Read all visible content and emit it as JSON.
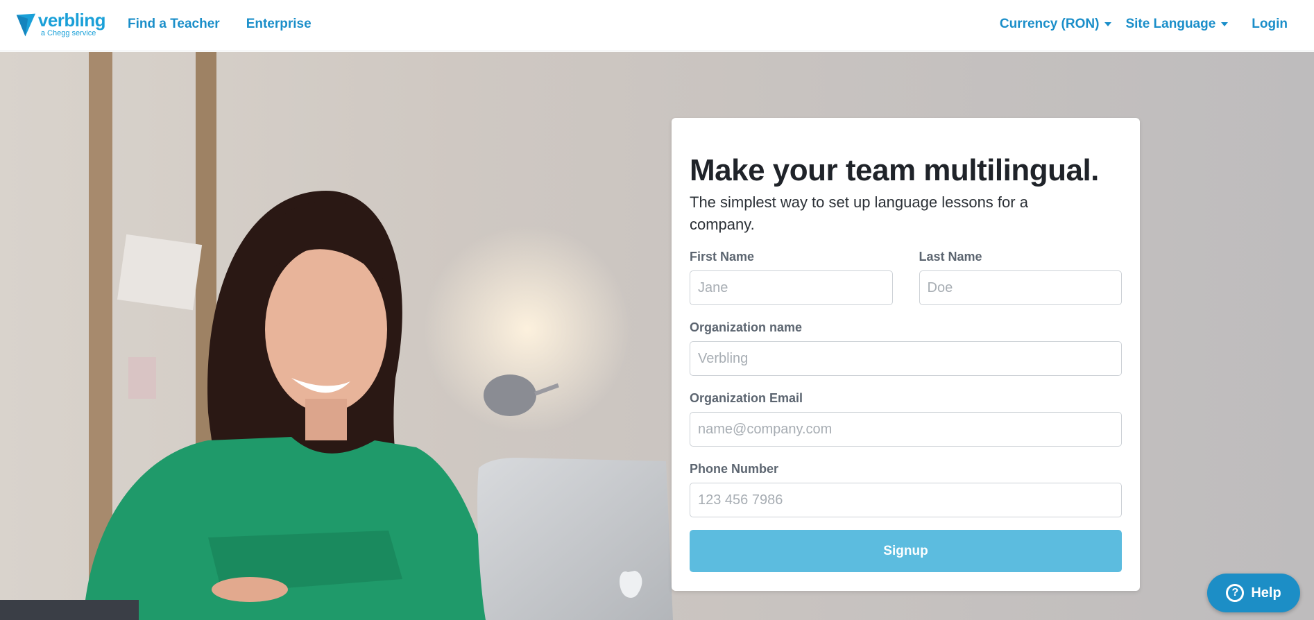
{
  "header": {
    "logo_word": "verbling",
    "logo_tagline": "a Chegg service",
    "nav_left": [
      "Find a Teacher",
      "Enterprise"
    ],
    "currency_label": "Currency (RON)",
    "site_language_label": "Site Language",
    "login_label": "Login"
  },
  "form": {
    "title": "Make your team multilingual.",
    "subtitle": "The simplest way to set up language lessons for a company.",
    "first_name": {
      "label": "First Name",
      "placeholder": "Jane",
      "value": ""
    },
    "last_name": {
      "label": "Last Name",
      "placeholder": "Doe",
      "value": ""
    },
    "organization_name": {
      "label": "Organization name",
      "placeholder": "Verbling",
      "value": ""
    },
    "organization_email": {
      "label": "Organization Email",
      "placeholder": "name@company.com",
      "value": ""
    },
    "phone_number": {
      "label": "Phone Number",
      "placeholder": "123 456 7986",
      "value": ""
    },
    "submit_label": "Signup"
  },
  "help": {
    "label": "Help",
    "icon": "question-circle-icon"
  },
  "hero": {
    "image": "woman in green sweater smiling at laptop"
  },
  "colors": {
    "brand_blue": "#1a8ec9",
    "signup_button": "#5cbcdf",
    "help_button": "#1c8ec6",
    "sweater_green": "#1f9a6a"
  }
}
